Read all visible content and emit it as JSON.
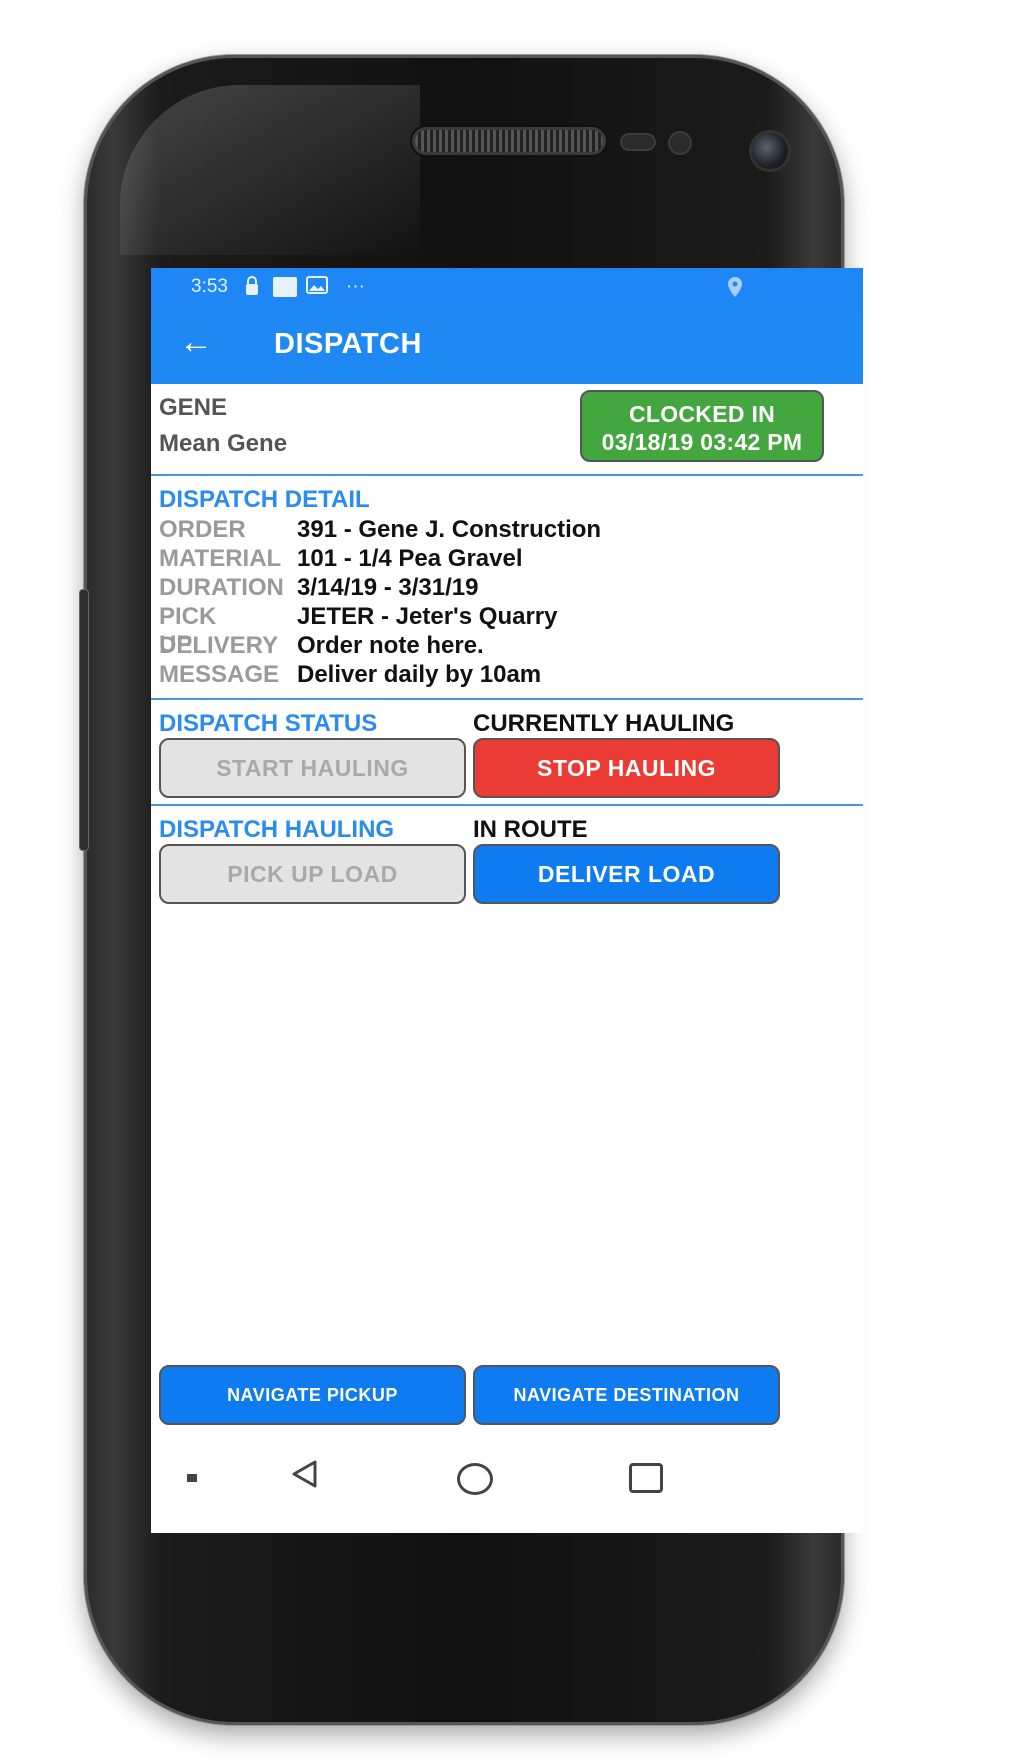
{
  "status_bar": {
    "time": "3:53",
    "icons": [
      "lock-icon",
      "notification-box-icon",
      "image-icon",
      "more-dots-icon",
      "location-icon"
    ],
    "dots": "···"
  },
  "app_bar": {
    "back_icon": "←",
    "title": "DISPATCH"
  },
  "user": {
    "id": "GENE",
    "name": "Mean Gene"
  },
  "clock": {
    "line1": "CLOCKED IN",
    "line2": "03/18/19 03:42 PM"
  },
  "dispatch_detail": {
    "heading": "DISPATCH DETAIL",
    "rows": [
      {
        "label": "ORDER",
        "value": "391 - Gene J. Construction"
      },
      {
        "label": "MATERIAL",
        "value": "101 - 1/4 Pea Gravel"
      },
      {
        "label": "DURATION",
        "value": "3/14/19 - 3/31/19"
      },
      {
        "label": "PICK UP",
        "value": "JETER - Jeter's Quarry"
      },
      {
        "label": "DELIVERY",
        "value": "Order note here."
      },
      {
        "label": "MESSAGE",
        "value": "Deliver daily by 10am"
      }
    ]
  },
  "dispatch_status": {
    "heading": "DISPATCH STATUS",
    "state": "CURRENTLY HAULING",
    "start_label": "START HAULING",
    "stop_label": "STOP HAULING"
  },
  "dispatch_hauling": {
    "heading": "DISPATCH HAULING",
    "state": "IN ROUTE",
    "pickup_label": "PICK UP LOAD",
    "deliver_label": "DELIVER LOAD"
  },
  "navigation": {
    "pickup_label": "NAVIGATE PICKUP",
    "destination_label": "NAVIGATE DESTINATION"
  },
  "colors": {
    "primary": "#1e88f3",
    "clocked_in": "#44a63f",
    "stop": "#ea3b34",
    "disabled": "#e3e3e3",
    "accent_text": "#2a8cf0"
  }
}
